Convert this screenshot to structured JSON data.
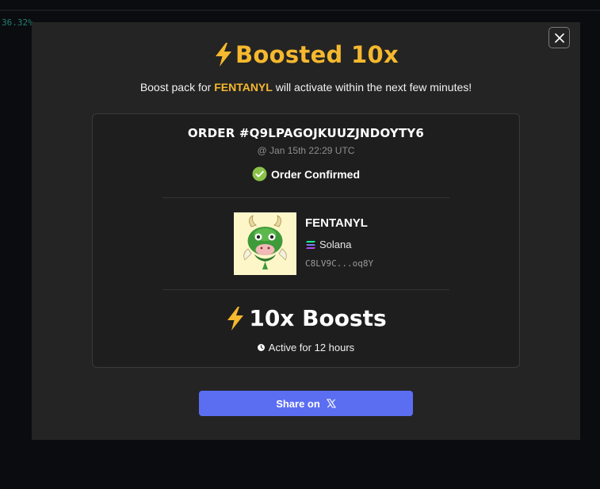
{
  "background": {
    "ticker_percent": "36.32%"
  },
  "modal": {
    "title": "Boosted 10x",
    "subtitle_prefix": "Boost pack for ",
    "subtitle_token": "FENTANYL",
    "subtitle_suffix": " will activate within the next few minutes!",
    "close_icon": "close-icon"
  },
  "order": {
    "id": "ORDER #Q9LPAGOJKUUZJNDOYTY6",
    "date": "@ Jan 15th 22:29 UTC",
    "status": "Order Confirmed"
  },
  "token": {
    "name": "FENTANYL",
    "chain": "Solana",
    "address": "C8LV9C...oq8Y"
  },
  "boost": {
    "label": "10x Boosts",
    "duration": "Active for 12 hours"
  },
  "share": {
    "label": "Share on"
  },
  "colors": {
    "accent": "#f5b82e",
    "button": "#5b6ef2",
    "check": "#8bc34a",
    "modal_bg": "#242424"
  }
}
